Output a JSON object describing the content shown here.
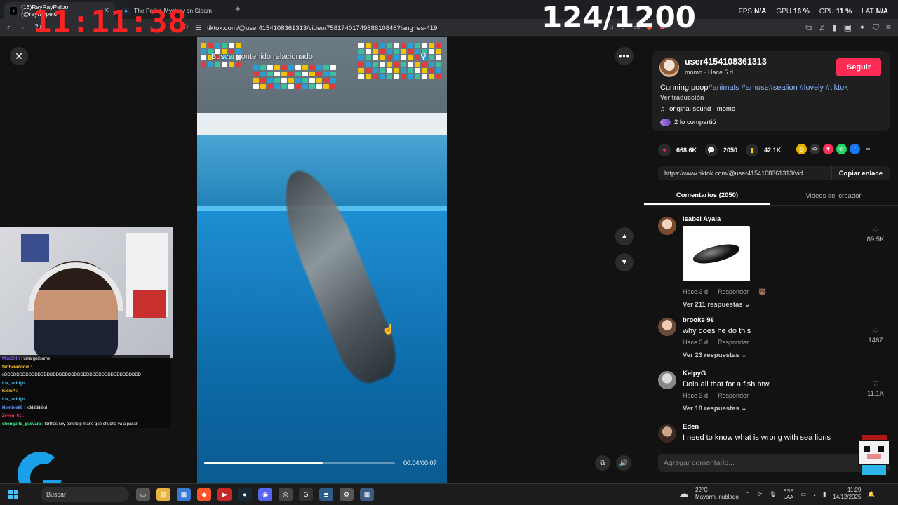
{
  "browser": {
    "tabs": [
      {
        "label": "(16)RayRayPeloo (@rayraypelo",
        "active": true,
        "icon": "tiktok-icon"
      },
      {
        "label": "The Police Mystery en Steam",
        "active": false,
        "icon": "steam-icon"
      }
    ],
    "new_tab_glyph": "+",
    "url": "tiktok.com/@user4154108361313/video/7581740174988610846?lang=es-419"
  },
  "overlay": {
    "clock": "11:11:38",
    "counter": "124/1200",
    "stats": [
      {
        "label": "FPS",
        "value": "N/A"
      },
      {
        "label": "GPU",
        "value": "16 %"
      },
      {
        "label": "CPU",
        "value": "11 %"
      },
      {
        "label": "LAT",
        "value": "N/A"
      }
    ]
  },
  "video": {
    "search_related": "Buscar contenido relacionado",
    "time": "00:04/00:07",
    "progress": 0.62
  },
  "chat": [
    {
      "user": "MosShin",
      "color": "#8a5cff",
      "msg": "uma godsume"
    },
    {
      "user": "fertherandom",
      "color": "#ffcc33",
      "msg": ""
    },
    {
      "user": "",
      "color": "#ffffff",
      "msg": "xDDDDDDDDDDDDDDDDDDDDDDDDDDDDDDDDDDDDDDDDDDDDD"
    },
    {
      "user": "ice_rodrigo",
      "color": "#33ccff",
      "msg": ""
    },
    {
      "user": "KleisP",
      "color": "#ffcc33",
      "msg": ""
    },
    {
      "user": "ice_rodrigo",
      "color": "#33ccff",
      "msg": ""
    },
    {
      "user": "Hombre69",
      "color": "#6699ff",
      "msg": "xddddddxd"
    },
    {
      "user": "Zeven_01",
      "color": "#ff3366",
      "msg": ""
    },
    {
      "user": "chonguito_guevara",
      "color": "#33ff99",
      "msg": "farthas soy potero p mano qué chucha va a pasar"
    }
  ],
  "post": {
    "username": "user4154108361313",
    "sub": "momo · Hace 5 d",
    "follow": "Seguir",
    "desc_text": "Cunning poop",
    "hashtags": "#animals #amuse#sealion #lovely #tiktok",
    "translate": "Ver traducción",
    "sound": "original sound - momo",
    "shared": "2 lo compartió",
    "likes": "668.6K",
    "comments": "2050",
    "saves": "42.1K",
    "link": "https://www.tiktok.com/@user4154108361313/vid...",
    "copy": "Copiar enlace",
    "tab_comments": "Comentarios (2050)",
    "tab_creator": "Videos del creador"
  },
  "comments": [
    {
      "name": "Isabel Ayala",
      "text": "",
      "meta": "Hace 3 d",
      "reply": "Responder",
      "replies": "Ver 211 respuestas",
      "likes": "89.5K"
    },
    {
      "name": "brooke 9€",
      "text": "why does he do this",
      "meta": "Hace 3 d",
      "reply": "Responder",
      "replies": "Ver 23 respuestas",
      "likes": "1467"
    },
    {
      "name": "KelpyG",
      "text": "Doin all that for a fish btw",
      "meta": "Hace 3 d",
      "reply": "Responder",
      "replies": "Ver 18 respuestas",
      "likes": "11.1K"
    },
    {
      "name": "Eden",
      "text": "I need to know what is wrong with sea lions",
      "meta": "",
      "reply": "",
      "replies": "",
      "likes": ""
    }
  ],
  "add_comment": "Agregar comentario...",
  "taskbar": {
    "search": "Buscar",
    "weather_temp": "22°C",
    "weather_desc": "Mayorm. nublado",
    "lang1": "ESP",
    "lang2": "LAA",
    "time": "11:29",
    "date": "14/12/2025"
  }
}
